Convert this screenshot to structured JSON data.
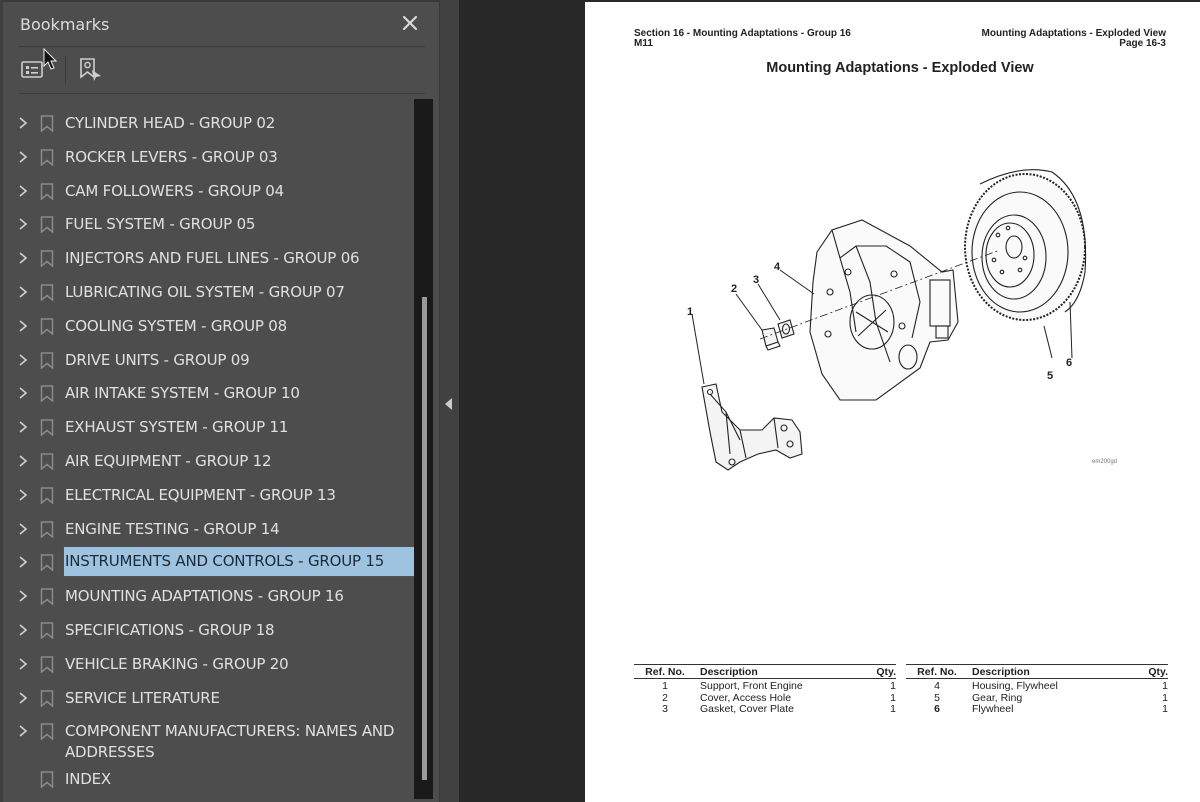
{
  "sidebar": {
    "title": "Bookmarks",
    "close_icon": "close-icon",
    "tools": [
      {
        "name": "bookmark-options-icon"
      },
      {
        "name": "expand-current-bookmark-icon"
      }
    ],
    "items": [
      {
        "label": "CYLINDER HEAD - GROUP 02",
        "expandable": true
      },
      {
        "label": "ROCKER LEVERS - GROUP 03",
        "expandable": true
      },
      {
        "label": "CAM FOLLOWERS - GROUP 04",
        "expandable": true
      },
      {
        "label": "FUEL SYSTEM - GROUP 05",
        "expandable": true
      },
      {
        "label": "INJECTORS AND FUEL LINES - GROUP 06",
        "expandable": true
      },
      {
        "label": "LUBRICATING OIL SYSTEM - GROUP 07",
        "expandable": true
      },
      {
        "label": "COOLING SYSTEM - GROUP 08",
        "expandable": true
      },
      {
        "label": "DRIVE UNITS - GROUP 09",
        "expandable": true
      },
      {
        "label": "AIR INTAKE SYSTEM - GROUP 10",
        "expandable": true
      },
      {
        "label": "EXHAUST SYSTEM - GROUP 11",
        "expandable": true
      },
      {
        "label": "AIR EQUIPMENT - GROUP 12",
        "expandable": true
      },
      {
        "label": "ELECTRICAL EQUIPMENT - GROUP 13",
        "expandable": true
      },
      {
        "label": "ENGINE TESTING - GROUP 14",
        "expandable": true
      },
      {
        "label": "INSTRUMENTS AND CONTROLS - GROUP 15",
        "expandable": true,
        "selected": true
      },
      {
        "label": "MOUNTING ADAPTATIONS - GROUP 16",
        "expandable": true
      },
      {
        "label": "SPECIFICATIONS - GROUP 18",
        "expandable": true
      },
      {
        "label": "VEHICLE BRAKING - GROUP 20",
        "expandable": true
      },
      {
        "label": "SERVICE LITERATURE",
        "expandable": true
      },
      {
        "label": "COMPONENT MANUFACTURERS:  NAMES AND ADDRESSES",
        "expandable": true,
        "wrap": true
      },
      {
        "label": "INDEX",
        "expandable": false
      }
    ],
    "colors": {
      "panel": "#4d4d4d",
      "text": "#e0e0e0",
      "selected_bg": "#9dc3e0"
    }
  },
  "document": {
    "header_left_line1": "Section 16 - Mounting Adaptations - Group 16",
    "header_left_line2": "M11",
    "header_right_line1": "Mounting Adaptations - Exploded View",
    "header_right_line2": "Page 16-3",
    "title": "Mounting Adaptations - Exploded View",
    "figure_id": "em200gd",
    "callouts": [
      "1",
      "2",
      "3",
      "4",
      "5",
      "6"
    ],
    "table_headers": {
      "ref": "Ref. No.",
      "desc": "Description",
      "qty": "Qty."
    },
    "parts_left": [
      {
        "ref": "1",
        "desc": "Support, Front Engine",
        "qty": "1"
      },
      {
        "ref": "2",
        "desc": "Cover, Access Hole",
        "qty": "1"
      },
      {
        "ref": "3",
        "desc": "Gasket, Cover Plate",
        "qty": "1"
      }
    ],
    "parts_right": [
      {
        "ref": "4",
        "desc": "Housing, Flywheel",
        "qty": "1"
      },
      {
        "ref": "5",
        "desc": "Gear, Ring",
        "qty": "1"
      },
      {
        "ref": "6",
        "desc": "Flywheel",
        "qty": "1"
      }
    ]
  }
}
